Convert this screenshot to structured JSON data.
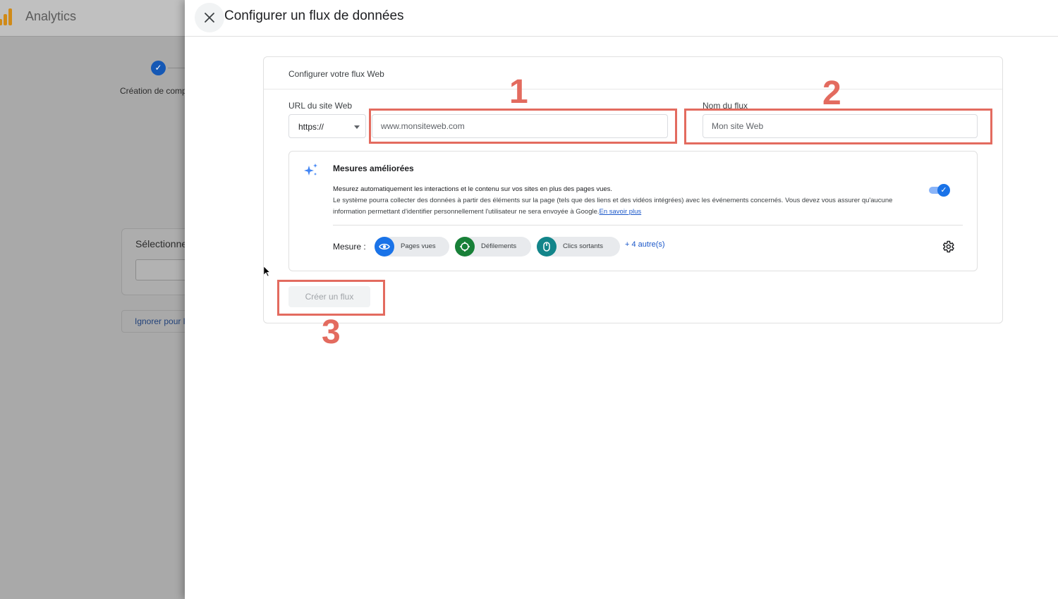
{
  "background_app": {
    "title": "Analytics",
    "step_check": "✓",
    "step_label": "Création de compte",
    "card_label": "Sélectionnez une plateforme",
    "skip_button": "Ignorer pour l'instant"
  },
  "panel": {
    "title": "Configurer un flux de données"
  },
  "card": {
    "header": "Configurer votre flux Web",
    "url_label": "URL du site Web",
    "protocol_value": "https://",
    "url_placeholder": "www.monsiteweb.com",
    "stream_name_label": "Nom du flux",
    "stream_name_placeholder": "Mon site Web"
  },
  "enhanced_measurement": {
    "title": "Mesures améliorées",
    "desc_line1": "Mesurez automatiquement les interactions et le contenu sur vos sites en plus des pages vues.",
    "desc_line2": "Le système pourra collecter des données à partir des éléments sur la page (tels que des liens et des vidéos intégrées) avec les événements concernés. Vous devez vous assurer qu'aucune information permettant d'identifier personnellement l'utilisateur ne sera envoyée à Google.",
    "learn_more": "En savoir plus",
    "enabled": true,
    "measure_label": "Mesure :",
    "chips": [
      {
        "label": "Pages vues",
        "icon": "eye-icon",
        "color": "#1a73e8"
      },
      {
        "label": "Défilements",
        "icon": "crosshair-icon",
        "color": "#188038"
      },
      {
        "label": "Clics sortants",
        "icon": "mouse-icon",
        "color": "#12858a"
      }
    ],
    "more": "+ 4 autre(s)"
  },
  "create_button": "Créer un flux",
  "annotations": [
    "1",
    "2",
    "3"
  ],
  "colors": {
    "annotation": "#e36b5f",
    "primary": "#1a73e8",
    "link": "#1a57c9"
  }
}
